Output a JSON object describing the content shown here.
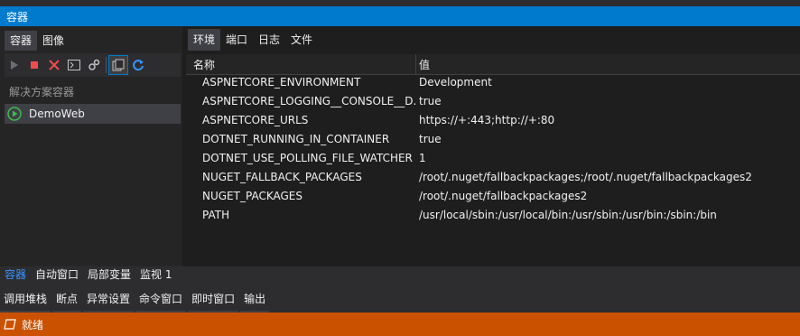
{
  "window": {
    "title": "容器"
  },
  "left": {
    "tabs": [
      {
        "label": "容器"
      },
      {
        "label": "图像"
      }
    ],
    "toolbar_icons": [
      "play-icon",
      "stop-icon",
      "delete-icon",
      "terminal-icon",
      "settings-icon",
      "copy-files-icon",
      "refresh-icon"
    ],
    "solution_header": "解决方案容器",
    "tree": [
      {
        "label": "DemoWeb",
        "status": "running"
      }
    ]
  },
  "right": {
    "tabs": [
      {
        "label": "环境"
      },
      {
        "label": "端口"
      },
      {
        "label": "日志"
      },
      {
        "label": "文件"
      }
    ],
    "columns": {
      "name": "名称",
      "value": "值"
    },
    "rows": [
      {
        "name": "ASPNETCORE_ENVIRONMENT",
        "value": "Development"
      },
      {
        "name": "ASPNETCORE_LOGGING__CONSOLE__D...",
        "value": "true"
      },
      {
        "name": "ASPNETCORE_URLS",
        "value": "https://+:443;http://+:80"
      },
      {
        "name": "DOTNET_RUNNING_IN_CONTAINER",
        "value": "true"
      },
      {
        "name": "DOTNET_USE_POLLING_FILE_WATCHER",
        "value": "1"
      },
      {
        "name": "NUGET_FALLBACK_PACKAGES",
        "value": "/root/.nuget/fallbackpackages;/root/.nuget/fallbackpackages2"
      },
      {
        "name": "NUGET_PACKAGES",
        "value": "/root/.nuget/fallbackpackages2"
      },
      {
        "name": "PATH",
        "value": "/usr/local/sbin:/usr/local/bin:/usr/sbin:/usr/bin:/sbin:/bin"
      }
    ]
  },
  "bottom_tabs": [
    {
      "label": "容器"
    },
    {
      "label": "自动窗口"
    },
    {
      "label": "局部变量"
    },
    {
      "label": "监视 1"
    }
  ],
  "bottom_panel_tabs": [
    {
      "label": "调用堆栈"
    },
    {
      "label": "断点"
    },
    {
      "label": "异常设置"
    },
    {
      "label": "命令窗口"
    },
    {
      "label": "即时窗口"
    },
    {
      "label": "输出"
    }
  ],
  "status": {
    "text": "就绪"
  },
  "colors": {
    "accent": "#007acc",
    "status_bar": "#ca5100",
    "run_green": "#3fb950",
    "stop_red": "#f14c4c",
    "link_blue": "#3794ff"
  }
}
